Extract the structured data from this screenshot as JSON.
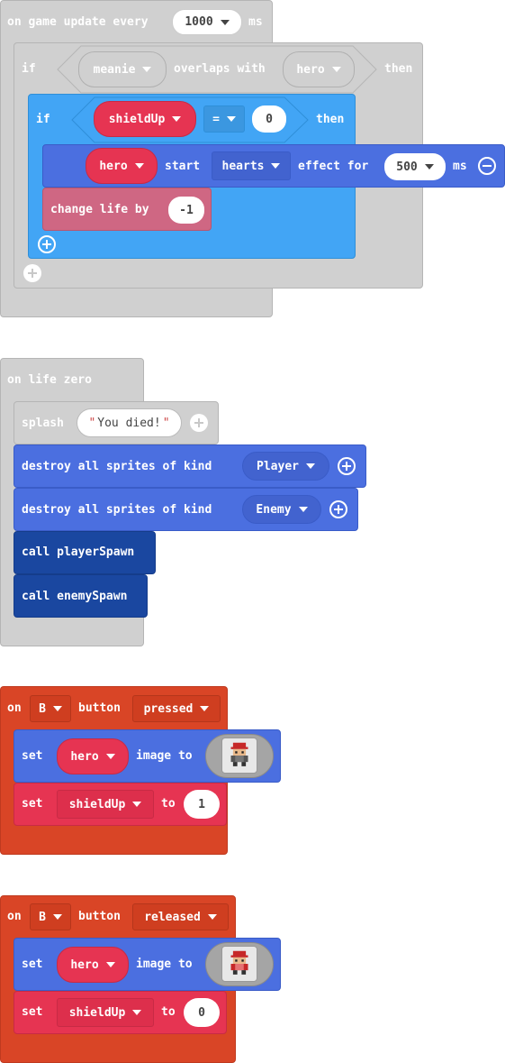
{
  "block1": {
    "header": [
      "on game update every",
      "ms"
    ],
    "interval": "1000",
    "if1": {
      "if": "if",
      "then": "then",
      "left": "meanie",
      "op": "overlaps with",
      "right": "hero"
    },
    "if2": {
      "if": "if",
      "then": "then",
      "var": "shieldUp",
      "op": "=",
      "value": "0"
    },
    "effect": {
      "sprite": "hero",
      "start": "start",
      "effect": "hearts",
      "for": "effect for",
      "duration": "500",
      "ms": "ms"
    },
    "life": {
      "label": "change life by",
      "value": "-1"
    }
  },
  "block2": {
    "header": "on life zero",
    "splash": {
      "label": "splash",
      "text": "You died!"
    },
    "destroy1": {
      "label": "destroy all sprites of kind",
      "kind": "Player"
    },
    "destroy2": {
      "label": "destroy all sprites of kind",
      "kind": "Enemy"
    },
    "call1": "call playerSpawn",
    "call2": "call enemySpawn"
  },
  "block3": {
    "on": "on",
    "button": "B",
    "button_label": "button",
    "event": "pressed",
    "set1": {
      "set": "set",
      "sprite": "hero",
      "image_to": "image to"
    },
    "set2": {
      "set": "set",
      "var": "shieldUp",
      "to": "to",
      "value": "1"
    }
  },
  "block4": {
    "on": "on",
    "button": "B",
    "button_label": "button",
    "event": "released",
    "set1": {
      "set": "set",
      "sprite": "hero",
      "image_to": "image to"
    },
    "set2": {
      "set": "set",
      "var": "shieldUp",
      "to": "to",
      "value": "0"
    }
  },
  "colors": {
    "events_gray": "#d0d0d0",
    "logic_blue": "#42a5f5",
    "sprites_blue": "#4b6fe0",
    "variables_red": "#e63452",
    "info_pink": "#cf6783",
    "functions_navy": "#1a47a0",
    "controller_orange": "#d94526"
  }
}
